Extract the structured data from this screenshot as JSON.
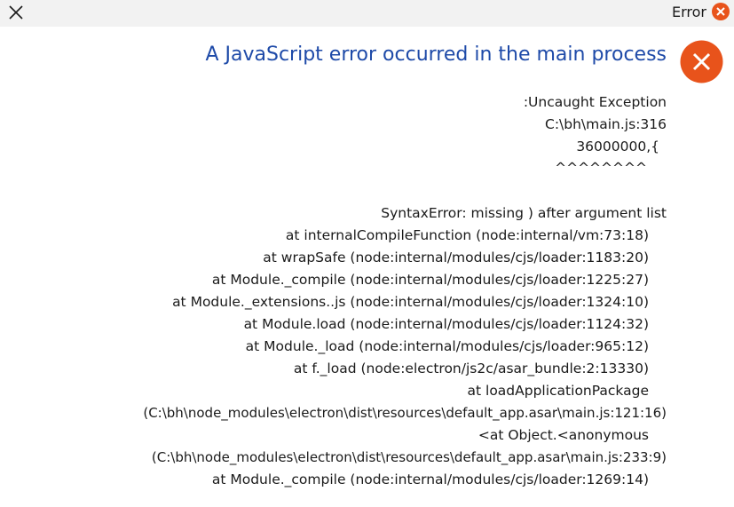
{
  "window": {
    "title": "Error",
    "heading": "A JavaScript error occurred in the main process"
  },
  "icons": {
    "close": "close-x-icon",
    "error": "error-circle-x-icon"
  },
  "colors": {
    "heading": "#1e4aa8",
    "error_icon": "#e8531b",
    "titlebar": "#f2f2f2"
  },
  "message": {
    "lines": [
      ":Uncaught Exception",
      "C:\\bh\\main.js:316",
      "36000000,{",
      "^^^^^^^^",
      "SyntaxError: missing ) after argument list",
      "at internalCompileFunction (node:internal/vm:73:18)",
      "at wrapSafe (node:internal/modules/cjs/loader:1183:20)",
      "at Module._compile (node:internal/modules/cjs/loader:1225:27)",
      "at Module._extensions..js (node:internal/modules/cjs/loader:1324:10)",
      "at Module.load (node:internal/modules/cjs/loader:1124:32)",
      "at Module._load (node:internal/modules/cjs/loader:965:12)",
      "at f._load (node:electron/js2c/asar_bundle:2:13330)",
      "at loadApplicationPackage",
      "(C:\\bh\\node_modules\\electron\\dist\\resources\\default_app.asar\\main.js:121:16)",
      "<at Object.<anonymous",
      "(C:\\bh\\node_modules\\electron\\dist\\resources\\default_app.asar\\main.js:233:9)",
      "at Module._compile (node:internal/modules/cjs/loader:1269:14)"
    ]
  }
}
